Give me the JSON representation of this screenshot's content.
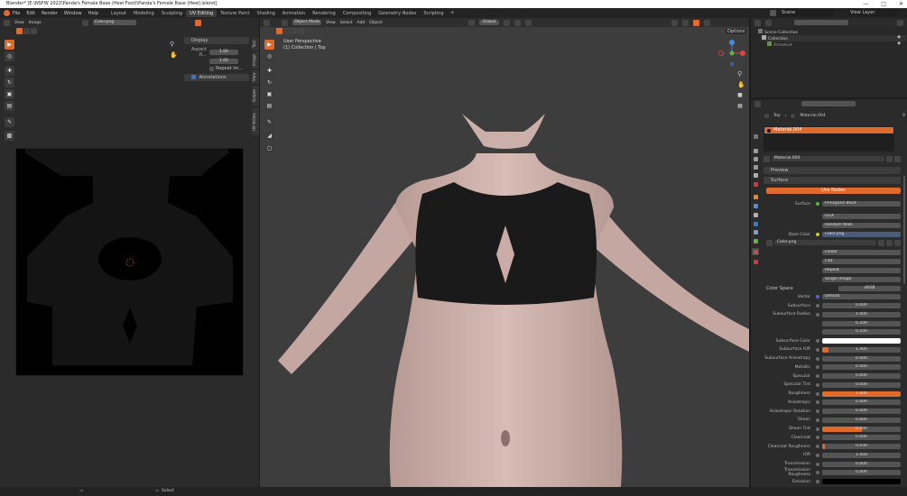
{
  "window": {
    "title": "Blender* [E:\\NSFW 2022\\Panda's Female Base (Heel Foot)\\Panda's Female Base (Heel).blend]"
  },
  "menu": [
    "File",
    "Edit",
    "Render",
    "Window",
    "Help"
  ],
  "workspaces": [
    "Layout",
    "Modeling",
    "Sculpting",
    "UV Editing",
    "Texture Paint",
    "Shading",
    "Animation",
    "Rendering",
    "Compositing",
    "Geometry Nodes",
    "Scripting"
  ],
  "active_workspace": "UV Editing",
  "uv_editor": {
    "menu": [
      "View",
      "Image"
    ],
    "image_name": "Color.png",
    "display_panel": "Display",
    "aspect_label": "Aspect R...",
    "aspect_x": "1.00",
    "aspect_y": "1.00",
    "repeat_label": "Repeat Im...",
    "annotations_label": "Annotations",
    "side_tabs": [
      "Tool",
      "Image",
      "View",
      "Scopes",
      "UV Vertex"
    ]
  },
  "viewport": {
    "mode": "Object Mode",
    "menu": [
      "View",
      "Select",
      "Add",
      "Object"
    ],
    "orientation": "Global",
    "perspective": "User Perspective",
    "collection": "(1) Collection | Top",
    "options": "Options"
  },
  "outliner": {
    "scene": "Scene",
    "view_layer": "View Layer",
    "scene_collection": "Scene Collection",
    "collection": "Collection",
    "armature": "Armature"
  },
  "properties": {
    "breadcrumb_object": "Top",
    "breadcrumb_material": "Material.004",
    "slot_material": "Material.004",
    "material_name": "Material.004",
    "preview": "Preview",
    "surface": "Surface",
    "use_nodes": "Use Nodes",
    "surface_label": "Surface",
    "surface_value": "Principled BSDF",
    "distribution": "GGX",
    "subsurface_method": "Random Walk",
    "base_color_label": "Base Color",
    "base_color_value": "Color.png",
    "image_name": "Color.png",
    "interp": "Linear",
    "projection": "Flat",
    "extension": "Repeat",
    "source": "Single Image",
    "color_space_label": "Color Space",
    "color_space": "sRGB",
    "vector_label": "Vector",
    "vector_value": "Default"
  },
  "prop_rows": [
    {
      "label": "Subsurface",
      "value": "0.000",
      "fill": 0
    },
    {
      "label": "Subsurface Radius",
      "value": "1.000",
      "fill": 0
    },
    {
      "label": "",
      "value": "0.200",
      "fill": 0
    },
    {
      "label": "",
      "value": "0.100",
      "fill": 0
    },
    {
      "label": "Subsurface Color",
      "value": "",
      "fill": 0,
      "swatch": "#ffffff"
    },
    {
      "label": "Subsurface IOR",
      "value": "1.400",
      "fill": 0.08,
      "orange": true
    },
    {
      "label": "Subsurface Anisotropy",
      "value": "0.000",
      "fill": 0
    },
    {
      "label": "Metallic",
      "value": "0.000",
      "fill": 0
    },
    {
      "label": "Specular",
      "value": "0.000",
      "fill": 0
    },
    {
      "label": "Specular Tint",
      "value": "0.000",
      "fill": 0
    },
    {
      "label": "Roughness",
      "value": "1.000",
      "fill": 1,
      "orange": true
    },
    {
      "label": "Anisotropic",
      "value": "0.000",
      "fill": 0
    },
    {
      "label": "Anisotropic Rotation",
      "value": "0.000",
      "fill": 0
    },
    {
      "label": "Sheen",
      "value": "0.000",
      "fill": 0
    },
    {
      "label": "Sheen Tint",
      "value": "0.500",
      "fill": 0.5,
      "orange": true
    },
    {
      "label": "Clearcoat",
      "value": "0.000",
      "fill": 0
    },
    {
      "label": "Clearcoat Roughness",
      "value": "0.030",
      "fill": 0.03,
      "orange": true
    },
    {
      "label": "IOR",
      "value": "1.450",
      "fill": 0
    },
    {
      "label": "Transmission",
      "value": "0.000",
      "fill": 0
    },
    {
      "label": "Transmission Roughness",
      "value": "0.000",
      "fill": 0
    },
    {
      "label": "Emission",
      "value": "",
      "fill": 0,
      "swatch": "#000000"
    },
    {
      "label": "Emission Strength",
      "value": "1.000",
      "fill": 0
    }
  ],
  "statusbar": {
    "select": "Select"
  },
  "colors": {
    "accent": "#e0692c",
    "blue": "#4772b3"
  }
}
